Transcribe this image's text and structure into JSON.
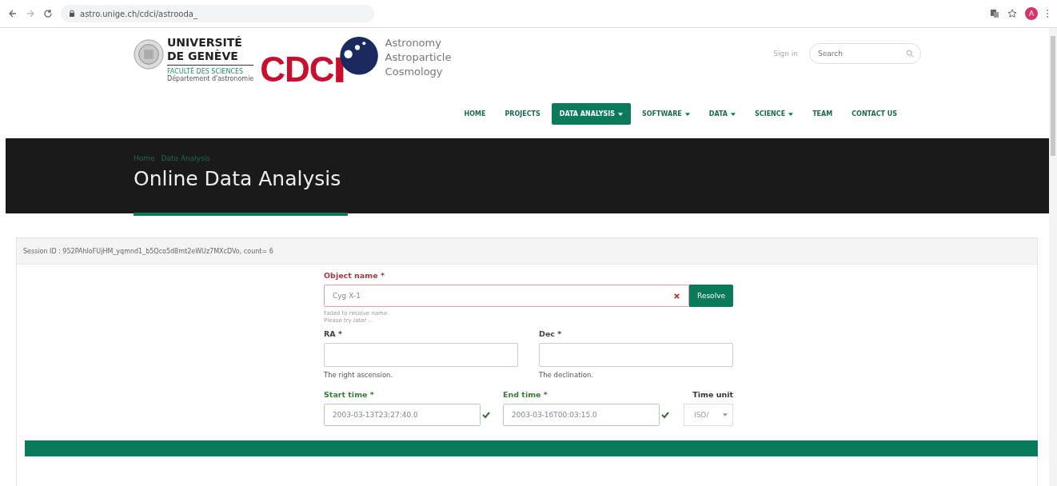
{
  "browser": {
    "url": "astro.unige.ch/cdci/astrooda_",
    "profile_initial": "A"
  },
  "header": {
    "university": [
      "UNIVERSITÉ",
      "DE GENÈVE"
    ],
    "faculty": "FACULTÉ DES SCIENCES",
    "department": "Département d'astronomie",
    "cdci": "CDC",
    "tagline": [
      "Astronomy",
      "Astroparticle",
      "Cosmology"
    ],
    "sign_in": "Sign in",
    "search": {
      "placeholder": "Search"
    }
  },
  "nav": [
    {
      "label": "HOME",
      "selected": false,
      "dropdown": false
    },
    {
      "label": "PROJECTS",
      "selected": false,
      "dropdown": false
    },
    {
      "label": "DATA ANALYSIS",
      "selected": true,
      "dropdown": true
    },
    {
      "label": "SOFTWARE",
      "selected": false,
      "dropdown": true
    },
    {
      "label": "DATA",
      "selected": false,
      "dropdown": true
    },
    {
      "label": "SCIENCE",
      "selected": false,
      "dropdown": true
    },
    {
      "label": "TEAM",
      "selected": false,
      "dropdown": false
    },
    {
      "label": "CONTACT US",
      "selected": false,
      "dropdown": false
    }
  ],
  "banner": {
    "breadcrumb": [
      "Home",
      "Data Analysis"
    ],
    "title": "Online Data Analysis"
  },
  "session": "Session ID : 952PAhIoFUjHM_yqmnd1_b5Qco5d8mt2eWUz7MXcDVo, count= 6",
  "object": {
    "label": "Object name *",
    "value": "Cyg X-1",
    "valid": false,
    "button": "Resolve",
    "messages": [
      "Failed to resolve name.",
      "Please try later ..."
    ]
  },
  "coords": [
    {
      "label": "RA *",
      "help": "The right ascension."
    },
    {
      "label": "Dec *",
      "help": "The declination."
    }
  ],
  "times": [
    {
      "label": "Start time *",
      "value": "2003-03-13T23:27:40.0",
      "valid": true
    },
    {
      "label": "End time *",
      "value": "2003-03-16T00:03:15.0",
      "valid": true
    }
  ],
  "time_unit": {
    "label": "Time unit",
    "value": "ISO/"
  }
}
